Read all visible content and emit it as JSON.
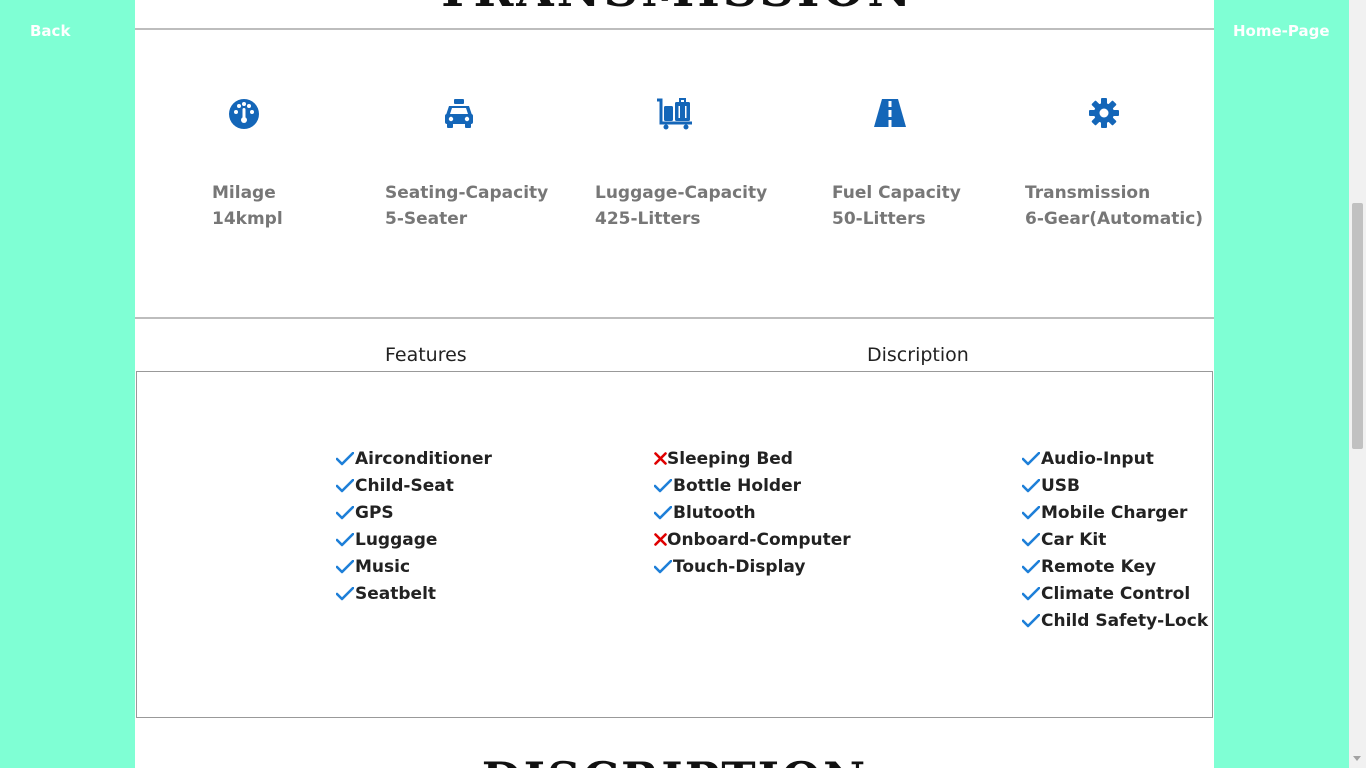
{
  "nav": {
    "back_label": "Back",
    "home_label": "Home-Page"
  },
  "top_heading": "TRANSMISSION",
  "specs": [
    {
      "icon": "speedometer-icon",
      "label": "Milage",
      "value": "14kmpl"
    },
    {
      "icon": "car-icon",
      "label": "Seating-Capacity",
      "value": "5-Seater"
    },
    {
      "icon": "luggage-cart-icon",
      "label": "Luggage-Capacity",
      "value": "425-Litters"
    },
    {
      "icon": "road-icon",
      "label": "Fuel Capacity",
      "value": "50-Litters"
    },
    {
      "icon": "gear-icon",
      "label": "Transmission",
      "value": "6-Gear(Automatic)"
    }
  ],
  "tabs": {
    "features": "Features",
    "description": "Discription"
  },
  "features": {
    "col1": [
      {
        "text": "Airconditioner",
        "available": true
      },
      {
        "text": "Child-Seat",
        "available": true
      },
      {
        "text": "GPS",
        "available": true
      },
      {
        "text": "Luggage",
        "available": true
      },
      {
        "text": "Music",
        "available": true
      },
      {
        "text": "Seatbelt",
        "available": true
      }
    ],
    "col2": [
      {
        "text": "Sleeping Bed",
        "available": false
      },
      {
        "text": "Bottle Holder",
        "available": true
      },
      {
        "text": "Blutooth",
        "available": true
      },
      {
        "text": "Onboard-Computer",
        "available": false
      },
      {
        "text": "Touch-Display",
        "available": true
      }
    ],
    "col3": [
      {
        "text": "Audio-Input",
        "available": true
      },
      {
        "text": "USB",
        "available": true
      },
      {
        "text": "Mobile Charger",
        "available": true
      },
      {
        "text": "Car Kit",
        "available": true
      },
      {
        "text": "Remote Key",
        "available": true
      },
      {
        "text": "Climate Control",
        "available": true
      },
      {
        "text": "Child Safety-Lock",
        "available": true
      }
    ]
  },
  "bottom_heading": "DISCRIPTION",
  "colors": {
    "background": "#7fffd4",
    "icon": "#1466b8",
    "check": "#1e7fd8",
    "cross": "#e00000",
    "spec_text": "#777777"
  }
}
